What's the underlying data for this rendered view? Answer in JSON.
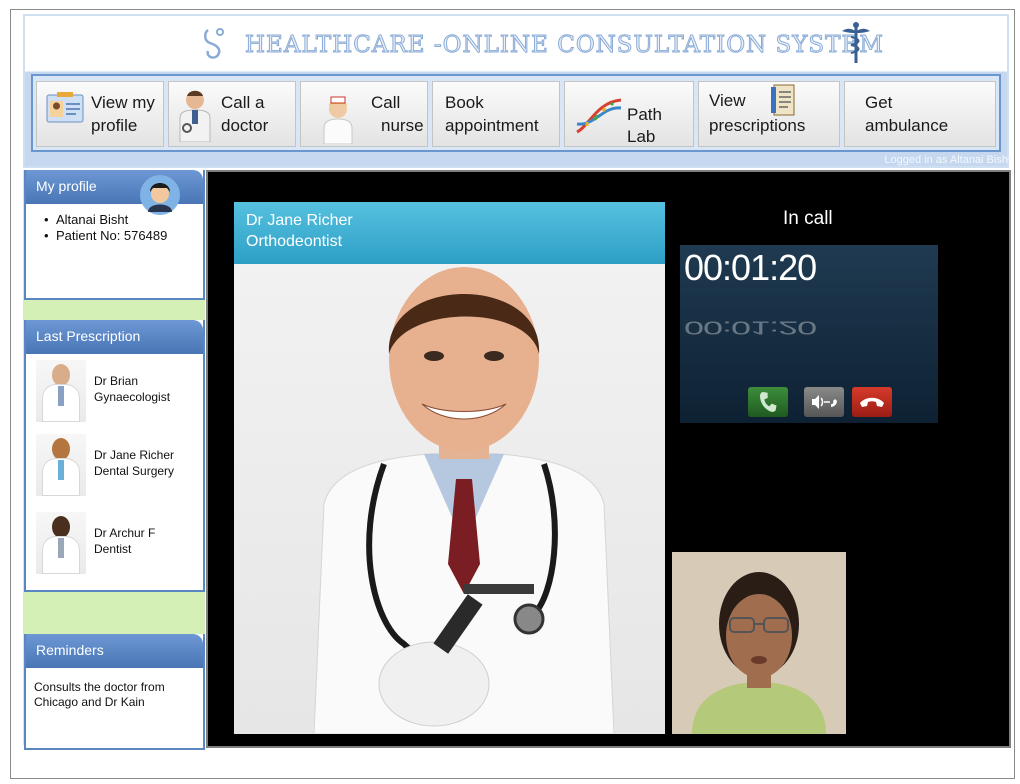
{
  "app": {
    "title": "HEALTHCARE -ONLINE CONSULTATION SYSTEM",
    "logged_in": "Logged in as Altanai Bisht"
  },
  "nav": [
    {
      "l1": "View my",
      "l2": "profile",
      "icon": "id-card-icon"
    },
    {
      "l1": "Call a",
      "l2": "doctor",
      "icon": "doctor-icon"
    },
    {
      "l1": "Call",
      "l2": "nurse",
      "icon": "nurse-icon"
    },
    {
      "l1": "Book",
      "l2": "appointment",
      "icon": ""
    },
    {
      "l1": "Path Lab",
      "l2": "",
      "icon": "dna-icon"
    },
    {
      "l1": "View",
      "l2": "prescriptions",
      "icon": "notebook-icon"
    },
    {
      "l1": "Get",
      "l2": "ambulance",
      "icon": ""
    }
  ],
  "sidebar": {
    "profile": {
      "heading": "My profile",
      "name": "Altanai Bisht",
      "patient_no": "Patient No: 576489"
    },
    "prescription": {
      "heading": "Last Prescription",
      "items": [
        {
          "name": "Dr Brian",
          "spec": "Gynaecologist"
        },
        {
          "name": "Dr Jane Richer",
          "spec": "Dental Surgery"
        },
        {
          "name": "Dr Archur F",
          "spec": "Dentist"
        }
      ]
    },
    "reminders": {
      "heading": "Reminders",
      "text": "Consults  the doctor from Chicago and Dr Kain"
    }
  },
  "call": {
    "doctor_name": "Dr Jane Richer",
    "doctor_specialty": "Orthodeontist",
    "status": "In call",
    "timer": "00:01:20"
  },
  "colors": {
    "accent": "#4b76b6",
    "caption": "#2d9fc6",
    "sidebar_bg": "#d4f0b7",
    "answer": "#2f7a2f",
    "hangup": "#c0281c"
  }
}
